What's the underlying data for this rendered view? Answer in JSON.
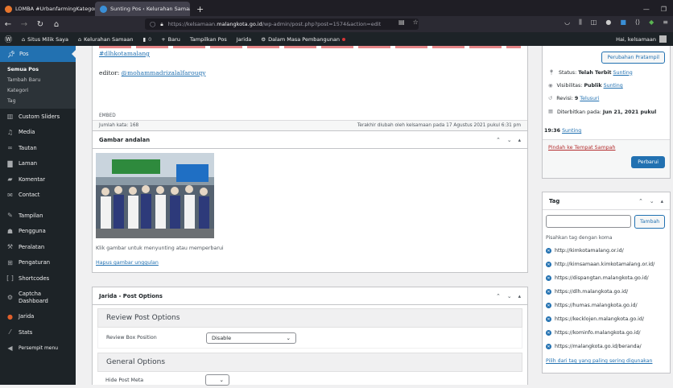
{
  "browser": {
    "tabs": [
      {
        "label": "LOMBA #UrbanfarmingKategori",
        "active": false
      },
      {
        "label": "Sunting Pos ‹ Kelurahan Samaan",
        "active": true
      }
    ],
    "url_prefix": "https://kelsamaan.",
    "url_domain": "malangkota.go.id",
    "url_path": "/wp-admin/post.php?post=1574&action=edit"
  },
  "adminbar": {
    "site_label": "Situs Milik Saya",
    "home_label": "Kelurahan Samaan",
    "comments_count": "0",
    "new_label": "Baru",
    "view_label": "Tampilkan Pos",
    "jarida_label": "Jarida",
    "maint_label": "Dalam Masa Pembangunan",
    "greeting": "Hai, kelsamaan"
  },
  "sidebar": {
    "pos_label": "Pos",
    "sub": [
      "Semua Pos",
      "Tambah Baru",
      "Kategori",
      "Tag"
    ],
    "items": [
      {
        "label": "Custom Sliders",
        "icon": "slider-icon"
      },
      {
        "label": "Media",
        "icon": "media-icon"
      },
      {
        "label": "Tautan",
        "icon": "link-icon"
      },
      {
        "label": "Laman",
        "icon": "page-icon"
      },
      {
        "label": "Komentar",
        "icon": "comment-icon"
      },
      {
        "label": "Contact",
        "icon": "mail-icon"
      },
      {
        "label": "Tampilan",
        "icon": "brush-icon"
      },
      {
        "label": "Pengguna",
        "icon": "user-icon"
      },
      {
        "label": "Peralatan",
        "icon": "wrench-icon"
      },
      {
        "label": "Pengaturan",
        "icon": "settings-icon"
      },
      {
        "label": "Shortcodes",
        "icon": "shortcode-icon"
      },
      {
        "label": "Captcha Dashboard",
        "icon": "gear-icon"
      },
      {
        "label": "Jarida",
        "icon": "jarida-icon"
      },
      {
        "label": "Stats",
        "icon": "stats-icon"
      },
      {
        "label": "Persempit menu",
        "icon": "collapse-icon"
      }
    ]
  },
  "editor": {
    "hashtag": "#dlhkotamalang",
    "editor_prefix": "editor: ",
    "editor_handle": "@mohammadrizalalfarouqy",
    "embed_label": "EMBED",
    "word_count": "Jumlah kata: 168",
    "last_edited": "Terakhir diubah oleh kelsamaan pada 17 Agustus 2021 pukul 6:31 pm"
  },
  "featured": {
    "title": "Gambar andalan",
    "hint": "Klik gambar untuk menyunting atau memperbarui",
    "remove_link": "Hapus gambar unggulan"
  },
  "jarida": {
    "title": "Jarida - Post Options",
    "review_heading": "Review Post Options",
    "review_label": "Review Box Position",
    "review_value": "Disable",
    "general_heading": "General Options",
    "hide_meta_label": "Hide Post Meta",
    "hide_meta_value": ""
  },
  "publish": {
    "preview_btn": "Perubahan Pratampil",
    "status_prefix": "Status: ",
    "status_value": "Telah Terbit",
    "visibility_prefix": "Visibilitas: ",
    "visibility_value": "Publik",
    "edit_label": "Sunting",
    "revisions_prefix": "Revisi: ",
    "revisions_count": "9",
    "revisions_link": "Telusuri",
    "published_prefix": "Diterbitkan pada: ",
    "published_date": "Jun 21, 2021 pukul",
    "published_time": "19:36",
    "trash_link": "Pindah ke Tempat Sampah",
    "update_btn": "Perbarui"
  },
  "tags": {
    "title": "Tag",
    "add_btn": "Tambah",
    "input_value": "",
    "hint": "Pisahkan tag dengan koma",
    "items": [
      "http://kimkotamalang.or.id/",
      "http://kimsamaan.kimkotamalang.or.id/",
      "https://dispangtan.malangkota.go.id/",
      "https://dlh.malangkota.go.id/",
      "https://humas.malangkota.go.id/",
      "https://kecklojen.malangkota.go.id/",
      "https://kominfo.malangkota.go.id/",
      "https://malangkota.go.id/beranda/"
    ],
    "popular_link": "Pilih dari tag yang paling sering digunakan"
  },
  "colors": {
    "accent": "#2271b1",
    "admin_bg": "#1d2327",
    "danger": "#d63638"
  }
}
